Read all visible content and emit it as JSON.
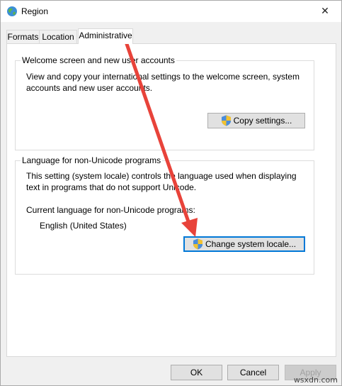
{
  "window": {
    "title": "Region",
    "close_glyph": "✕"
  },
  "tabs": [
    {
      "label": "Formats",
      "active": false
    },
    {
      "label": "Location",
      "active": false
    },
    {
      "label": "Administrative",
      "active": true
    }
  ],
  "welcome_group": {
    "title": "Welcome screen and new user accounts",
    "description_line1": "View and copy your international settings to the welcome screen, system",
    "description_line2": "accounts and new user accounts.",
    "button_label": "Copy settings..."
  },
  "language_group": {
    "title": "Language for non-Unicode programs",
    "description_line1": "This setting (system locale) controls the language used when displaying",
    "description_line2": "text in programs that do not support Unicode.",
    "current_label": "Current language for non-Unicode programs:",
    "current_value": "English (United States)",
    "button_label": "Change system locale..."
  },
  "footer": {
    "ok_label": "OK",
    "cancel_label": "Cancel",
    "apply_label": "Apply"
  },
  "annotation": {
    "arrow_color": "#e8433a"
  },
  "watermark": "wsxdn.com",
  "icons": {
    "title": "globe-icon",
    "close": "close-icon",
    "shield": "uac-shield-icon"
  }
}
